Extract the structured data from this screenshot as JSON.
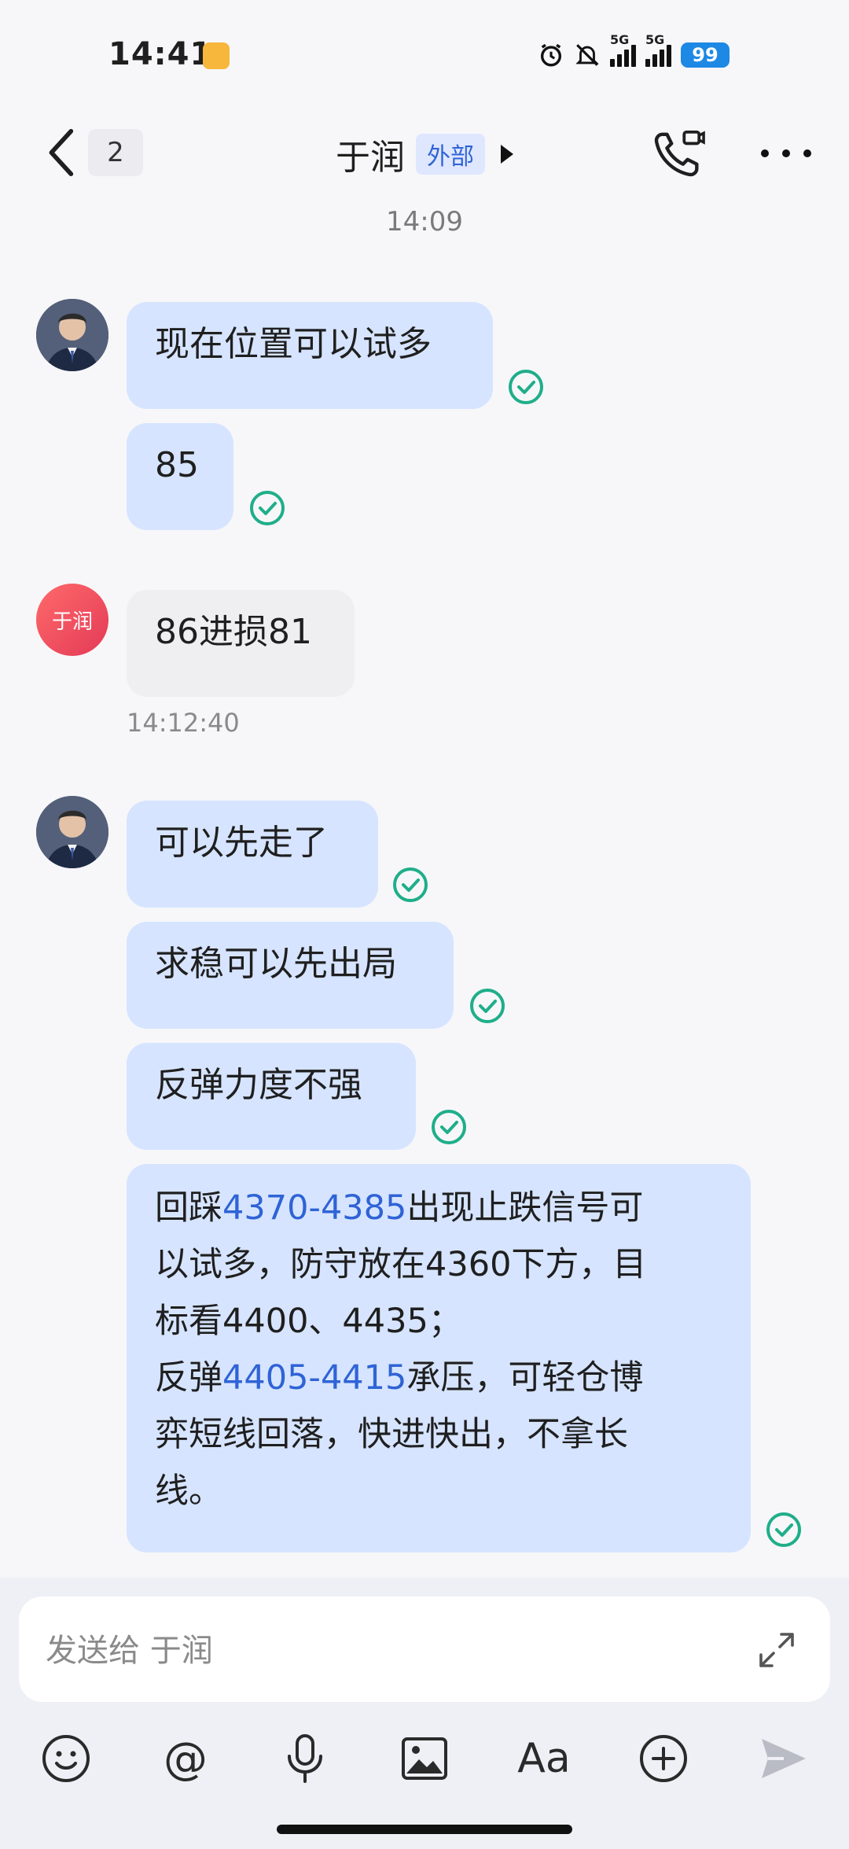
{
  "status_bar": {
    "time": "14:41",
    "signal_label_1": "5G",
    "signal_label_2": "5G",
    "battery": "99"
  },
  "header": {
    "back_count": "2",
    "title": "于润",
    "tag": "外部"
  },
  "chat": {
    "time_divider": "14:09",
    "avatar_text": "于润",
    "messages": [
      {
        "text": "现在位置可以试多"
      },
      {
        "text": "85"
      },
      {
        "text": "86进损81"
      },
      {
        "text": "可以先走了"
      },
      {
        "text": "求稳可以先出局"
      },
      {
        "text": "反弹力度不强"
      }
    ],
    "other_timestamp": "14:12:40",
    "long_message": {
      "p1": "回踩",
      "h1": "4370-4385",
      "p2": "出现止跌信号可",
      "line2": "以试多，防守放在4360下方，目",
      "line3": "标看4400、4435；",
      "p4a": "反弹",
      "h2": "4405-4415",
      "p4b": "承压，可轻仓博",
      "line5": "弈短线回落，快进快出，不拿长",
      "line6": "线。"
    }
  },
  "input": {
    "placeholder": "发送给 于润"
  },
  "toolbar": {
    "at_label": "@",
    "font_label": "Aa"
  },
  "colors": {
    "self_bubble": "#d6e4ff",
    "other_bubble": "#efeff2",
    "link": "#2f63d6",
    "check": "#1fae8a"
  }
}
